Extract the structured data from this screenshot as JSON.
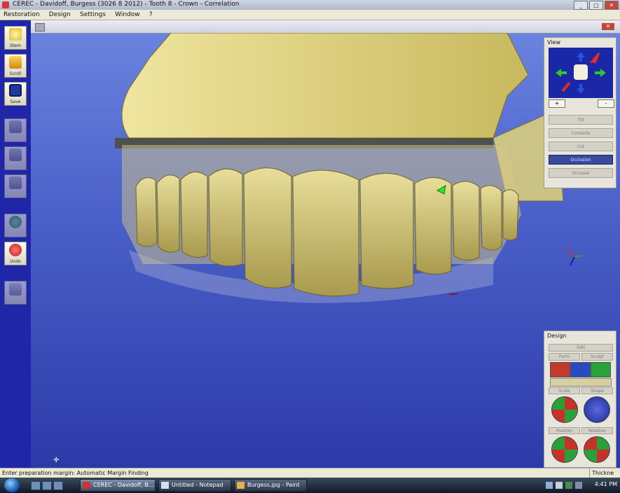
{
  "window": {
    "title": "CEREC - Davidoff, Burgess (3026 8 2012) - Tooth 8 - Crown - Correlation"
  },
  "menu": [
    "Restoration",
    "Design",
    "Settings",
    "Window",
    "?"
  ],
  "toolbar": [
    {
      "label": "Stem",
      "icon": "tooth-stem-icon"
    },
    {
      "label": "Scroll",
      "icon": "folder-icon"
    },
    {
      "label": "Save",
      "icon": "floppy-disk-icon"
    },
    {
      "label": "",
      "icon": "tooth-scan-icon"
    },
    {
      "label": "",
      "icon": "tooth-model-icon"
    },
    {
      "label": "",
      "icon": "tooth-crown-icon"
    },
    {
      "label": "",
      "icon": "forward-arrow-icon"
    },
    {
      "label": "Undo",
      "icon": "undo-arrow-icon"
    },
    {
      "label": "",
      "icon": "tooth-preview-icon"
    }
  ],
  "view_panel": {
    "title": "View",
    "plus": "+",
    "minus": "-",
    "buttons": [
      "Tilt",
      "Contacts",
      "Cut",
      "Occlusion",
      "Occlusal"
    ]
  },
  "design_panel": {
    "title": "Design",
    "top_button": "Edit",
    "tabs": [
      "Form",
      "Sculpt"
    ],
    "tool_labels": [
      "Scale",
      "Shape",
      "Position",
      "Rotation"
    ]
  },
  "statusbar": {
    "text": "Enter preparation margin: Automatic Margin Finding",
    "right": "Thickne"
  },
  "taskbar": {
    "tasks": [
      "CEREC - Davidoff, B...",
      "Untitled - Notepad",
      "Burgess.jpg - Paint"
    ],
    "clock": "4:41 PM"
  },
  "colors": {
    "viewport_top": "#6c86e0",
    "viewport_bottom": "#2c3aa8",
    "tooth": "#cfc27a",
    "active_button": "#3a4a9c",
    "toolbar_bg": "#2026a8"
  }
}
